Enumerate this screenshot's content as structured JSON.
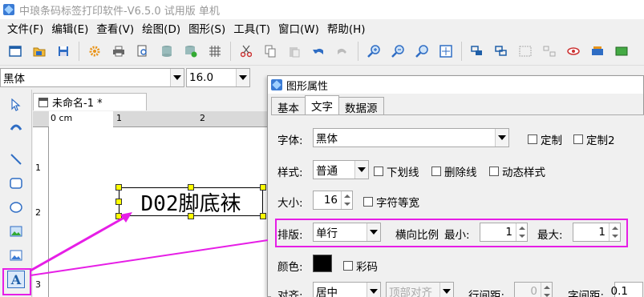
{
  "window": {
    "title": "中琅条码标签打印软件-V6.5.0 试用版 单机"
  },
  "menu": [
    "文件(F)",
    "编辑(E)",
    "查看(V)",
    "绘图(D)",
    "图形(S)",
    "工具(T)",
    "窗口(W)",
    "帮助(H)"
  ],
  "toolbar_icons": [
    "new-icon",
    "open-icon",
    "save-icon",
    "settings-icon",
    "print-icon",
    "print-preview-icon",
    "database-icon",
    "database-link-icon",
    "grid-icon",
    "cut-icon",
    "copy-icon",
    "paste-icon",
    "undo-icon",
    "redo-icon",
    "zoom-in-icon",
    "zoom-out-icon",
    "zoom-fit-icon",
    "fit-page-icon",
    "group-icon",
    "ungroup-icon",
    "align-icon",
    "distribute-icon",
    "eye-icon",
    "print-queue-icon",
    "export-icon"
  ],
  "fontbar": {
    "font": "黑体",
    "size": "16.0"
  },
  "document": {
    "tab_label": "未命名-1 *",
    "ruler_unit": "0 cm",
    "ruler_top_marks": [
      "1",
      "2"
    ],
    "ruler_left_marks": [
      "1",
      "2",
      "3"
    ],
    "element_text": "D02脚底袜"
  },
  "dialog": {
    "title": "图形属性",
    "tabs": [
      "基本",
      "文字",
      "数据源"
    ],
    "active_tab": "文字",
    "font_label": "字体:",
    "font_value": "黑体",
    "custom_label": "定制",
    "custom2_label": "定制2",
    "style_label": "样式:",
    "style_value": "普通",
    "underline_label": "下划线",
    "strikethrough_label": "删除线",
    "dynamic_style_label": "动态样式",
    "size_label": "大小:",
    "size_value": "16",
    "monospace_label": "字符等宽",
    "layout_label": "排版:",
    "layout_value": "单行",
    "hscale_label": "横向比例",
    "min_label": "最小:",
    "min_value": "1",
    "max_label": "最大:",
    "max_value": "1",
    "color_label": "颜色:",
    "color_value": "#000000",
    "colorcode_label": "彩码",
    "align_label": "对齐:",
    "align_value": "居中",
    "valign_value": "顶部对齐",
    "line_spacing_label": "行间距:",
    "line_spacing_value": "0",
    "char_spacing_label": "字间距:",
    "char_spacing_value": "0.1"
  },
  "colors": {
    "highlight": "#e61ee6",
    "handle": "#ffff00"
  }
}
